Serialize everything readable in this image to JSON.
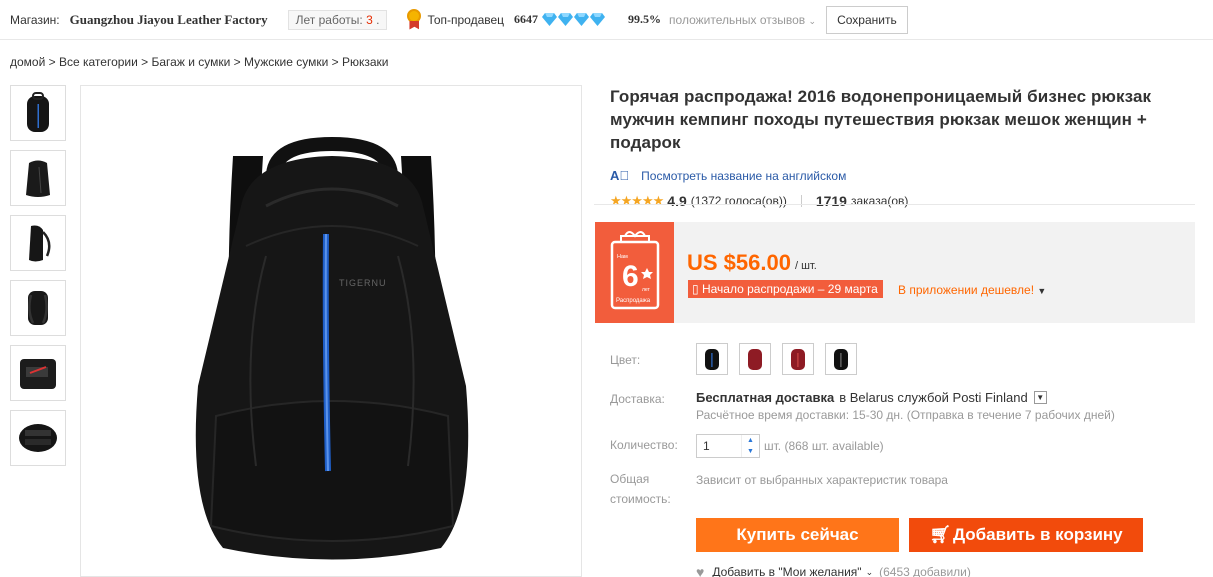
{
  "store": {
    "label": "Магазин:",
    "name": "Guangzhou Jiayou Leather Factory",
    "years_label": "Лет работы:",
    "years_value": "3",
    "years_dot": ".",
    "top_seller": "Топ-продавец",
    "score": "6647",
    "positive_pct": "99.5%",
    "feedback_label": "положительных отзывов",
    "save_button": "Сохранить",
    "icons": {
      "medal": "medal-icon",
      "diamond": "diamond-icon"
    },
    "diamond_count": 4
  },
  "breadcrumb": "домой > Все категории > Багаж и сумки > Мужские сумки > Рюкзаки",
  "thumbnails": [
    "backpack-front",
    "backpack-angle",
    "backpack-side",
    "backpack-back",
    "backpack-open",
    "backpack-interior"
  ],
  "product": {
    "title": "Горячая распродажа! 2016 водонепроницаемый бизнес рюкзак мужчин кемпинг походы путешествия рюкзак мешок женщин + подарок",
    "translate_link": "Посмотреть название на английском",
    "stars": "★★★★★",
    "rating": "4.9",
    "votes": "(1372 голоса(ов))",
    "orders_num": "1719",
    "orders_label": "заказа(ов)",
    "brand_on_image": "TIGERNU"
  },
  "price": {
    "value": "US $56.00",
    "unit": "/ шт.",
    "sale_badge": "Начало распродажи – 29 марта",
    "app_cheaper": "В приложении дешевле!",
    "promo": {
      "top": "Нам",
      "big": "6",
      "small": "лет",
      "bottom": "Распродажа"
    }
  },
  "props": {
    "color_label": "Цвет:",
    "colors": [
      "#111111",
      "#8e1b24",
      "#8e1b24",
      "#111111"
    ],
    "shipping_label": "Доставка:",
    "shipping_free": "Бесплатная доставка",
    "shipping_to": "в Belarus службой Posti Finland",
    "shipping_eta": "Расчётное время доставки: 15-30 дн. (Отправка в течение 7 рабочих дней)",
    "qty_label": "Количество:",
    "qty_value": "1",
    "qty_info": "шт. (868 шт. available)",
    "total_label_1": "Общая",
    "total_label_2": "стоимость:",
    "total_value": "Зависит от выбранных характеристик товара"
  },
  "actions": {
    "buy_now": "Купить сейчас",
    "add_to_cart": "Добавить в корзину",
    "wishlist": "Добавить в \"Мои желания\"",
    "wishlist_count": "(6453 добавили)"
  },
  "colors": {
    "accent": "#ff6600",
    "buy": "#ff7519",
    "cart": "#f24b0c",
    "promo": "#f25d3c",
    "link": "#2a5aa7"
  }
}
